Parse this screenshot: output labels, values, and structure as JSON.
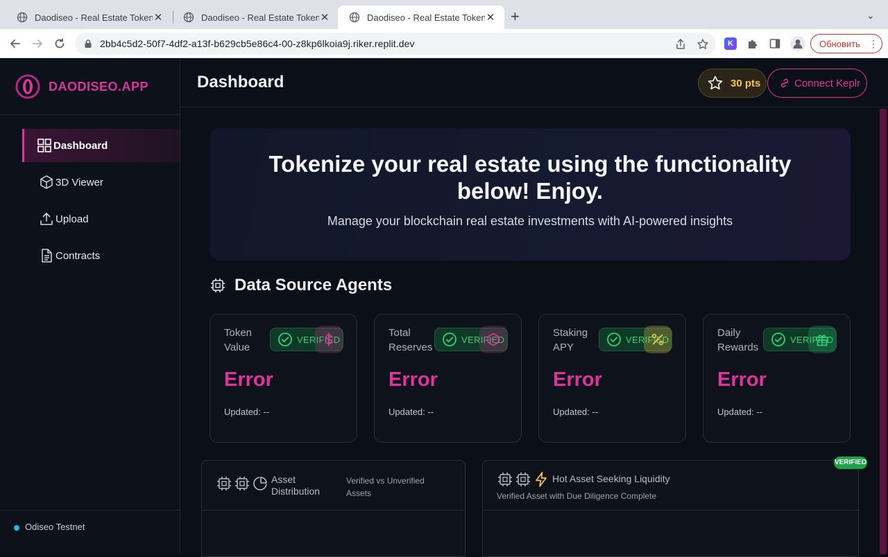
{
  "browser": {
    "tabs": [
      {
        "title": "Daodiseo - Real Estate Tokeniz",
        "active": false
      },
      {
        "title": "Daodiseo - Real Estate Tokeniz",
        "active": false
      },
      {
        "title": "Daodiseo - Real Estate Tokeniz",
        "active": true
      }
    ],
    "new_tab": "+",
    "tab_menu": "⌄",
    "url": "2bb4c5d2-50f7-4df2-a13f-b629cb5e86c4-00-z8kp6lkoia9j.riker.replit.dev",
    "update_label": "Обновить",
    "update_menu": "⋮",
    "extension_k": "K"
  },
  "sidebar": {
    "brand": "DAODISEO.APP",
    "items": [
      {
        "label": "Dashboard",
        "icon": "grid-icon",
        "active": true
      },
      {
        "label": "3D Viewer",
        "icon": "cube-icon",
        "active": false
      },
      {
        "label": "Upload",
        "icon": "upload-icon",
        "active": false
      },
      {
        "label": "Contracts",
        "icon": "document-icon",
        "active": false
      }
    ],
    "network": "Odiseo Testnet"
  },
  "header": {
    "title": "Dashboard",
    "points": "30 pts",
    "connect_label": "Connect Keplr"
  },
  "hero": {
    "title": "Tokenize your real estate using the functionality below! Enjoy.",
    "subtitle": "Manage your blockchain real estate investments with AI-powered insights"
  },
  "agents": {
    "title": "Data Source Agents",
    "cards": [
      {
        "label": "Token Value",
        "badge": "VERIFIED",
        "value": "Error",
        "updated": "Updated: --",
        "icon": "dollar-icon",
        "icon_color": "#e0339c"
      },
      {
        "label": "Total Reserves",
        "badge": "VERIFIED",
        "value": "Error",
        "updated": "Updated: --",
        "icon": "hexagon-icon",
        "icon_color": "#e0339c"
      },
      {
        "label": "Staking APY",
        "badge": "VERIFIED",
        "value": "Error",
        "updated": "Updated: --",
        "icon": "percent-icon",
        "icon_color": "#f6c343"
      },
      {
        "label": "Daily Rewards",
        "badge": "VERIFIED",
        "value": "Error",
        "updated": "Updated: --",
        "icon": "gift-icon",
        "icon_color": "#2fd27a"
      }
    ]
  },
  "panels": {
    "distribution": {
      "title": "Asset Distribution",
      "subtitle": "Verified vs Unverified Assets"
    },
    "hot_asset": {
      "title": "Hot Asset Seeking Liquidity",
      "subtitle": "Verified Asset with Due Diligence Complete",
      "badge": "VERIFIED"
    }
  },
  "colors": {
    "accent": "#e0339c",
    "gold": "#f6c343",
    "green": "#2fd27a",
    "background": "#0b0f17"
  }
}
